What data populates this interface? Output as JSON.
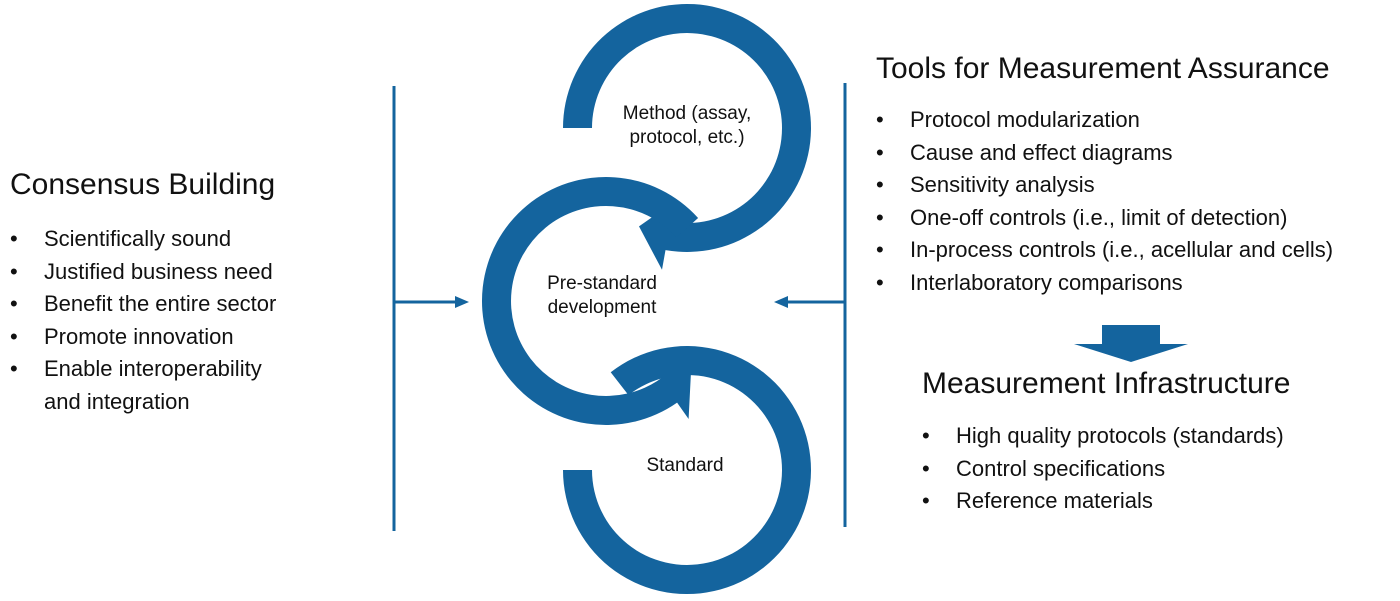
{
  "colors": {
    "accent": "#14649E",
    "text": "#111111",
    "background": "#FFFFFF"
  },
  "consensus": {
    "title": "Consensus Building",
    "items": [
      "Scientifically sound",
      "Justified business need",
      "Benefit the entire sector",
      "Promote innovation",
      "Enable interoperability",
      "and integration"
    ]
  },
  "cycle": {
    "nodes": [
      {
        "line1": "Method (assay,",
        "line2": "protocol, etc.)"
      },
      {
        "line1": "Pre-standard",
        "line2": "development"
      },
      {
        "line1": "Standard",
        "line2": ""
      }
    ]
  },
  "tools": {
    "title": "Tools for Measurement Assurance",
    "items": [
      "Protocol modularization",
      "Cause and effect diagrams",
      "Sensitivity analysis",
      "One-off controls (i.e., limit of detection)",
      "In-process controls (i.e., acellular and cells)",
      "Interlaboratory comparisons"
    ]
  },
  "infrastructure": {
    "title": "Measurement Infrastructure",
    "items": [
      "High quality protocols (standards)",
      "Control specifications",
      "Reference materials"
    ]
  },
  "icons": {
    "left_input_arrow": "arrow-right-icon",
    "right_input_arrow": "arrow-left-icon",
    "down_arrow": "arrow-down-icon"
  }
}
